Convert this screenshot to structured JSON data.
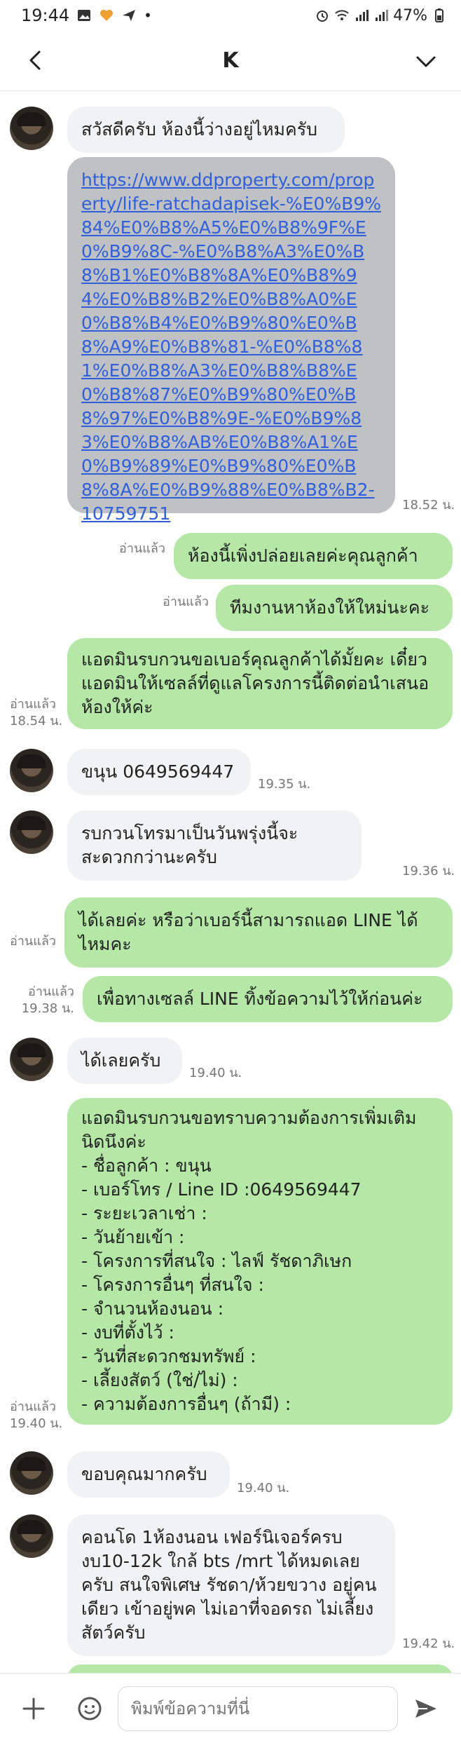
{
  "status": {
    "time": "19:44",
    "battery": "47%"
  },
  "header": {
    "title": "K"
  },
  "messages": {
    "m1": {
      "text": "สวัสดีครับ ห้องนี้ว่างอยู่ไหมครับ"
    },
    "m2": {
      "link": "https://www.ddproperty.com/property/life-ratchadapisek-%E0%B9%84%E0%B8%A5%E0%B8%9F%E0%B9%8C-%E0%B8%A3%E0%B8%B1%E0%B8%8A%E0%B8%94%E0%B8%B2%E0%B8%A0%E0%B8%B4%E0%B9%80%E0%B8%A9%E0%B8%81-%E0%B8%81%E0%B8%A3%E0%B8%B8%E0%B8%87%E0%B9%80%E0%B8%97%E0%B8%9E-%E0%B9%83%E0%B8%AB%E0%B8%A1%E0%B9%89%E0%B9%80%E0%B8%8A%E0%B9%88%E0%B8%B2-10759751",
      "time": "18.52 น."
    },
    "m3": {
      "text": "ห้องนี้เพิ่งปล่อยเลยค่ะคุณลูกค้า",
      "read": "อ่านแล้ว"
    },
    "m4": {
      "text": "ทีมงานหาห้องให้ใหม่นะคะ",
      "read": "อ่านแล้ว"
    },
    "m5": {
      "text": "แอดมินรบกวนขอเบอร์คุณลูกค้าได้มั้ยคะ เดี๋ยวแอดมินให้เซลล์ที่ดูแลโครงการนี้ติดต่อนำเสนอห้องให้ค่ะ",
      "read": "อ่านแล้ว",
      "time": "18.54 น."
    },
    "m6": {
      "text": "ขนุน 0649569447",
      "time": "19.35 น."
    },
    "m7": {
      "text": "รบกวนโทรมาเป็นวันพรุ่งนี้จะสะดวกกว่านะครับ",
      "time": "19.36 น."
    },
    "m8": {
      "text": "ได้เลยค่ะ หรือว่าเบอร์นี้สามารถแอด LINE ได้ไหมคะ",
      "read": "อ่านแล้ว"
    },
    "m9": {
      "text": "เพื่อทางเซลล์ LINE ทิ้งข้อความไว้ให้ก่อนค่ะ",
      "read": "อ่านแล้ว",
      "time": "19.38 น."
    },
    "m10": {
      "text": "ได้เลยครับ",
      "time": "19.40 น."
    },
    "m11": {
      "text": "แอดมินรบกวนขอทราบความต้องการเพิ่มเติมนิดนึงค่ะ\n- ชื่อลูกค้า : ขนุน\n- เบอร์โทร / Line ID :0649569447\n- ระยะเวลาเช่า :\n- วันย้ายเข้า :\n- โครงการที่สนใจ : ไลฟ์ รัชดาภิเษก\n- โครงการอื่นๆ ที่สนใจ :\n- จำนวนห้องนอน :\n- งบที่ตั้งไว้ :\n- วันที่สะดวกชมทรัพย์ :\n- เลี้ยงสัตว์ (ใช่/ไม่) :\n- ความต้องการอื่นๆ (ถ้ามี) :",
      "read": "อ่านแล้ว",
      "time": "19.40 น."
    },
    "m12": {
      "text": "ขอบคุณมากครับ",
      "time": "19.40 น."
    },
    "m13": {
      "text": "คอนโด 1ห้องนอน เฟอร์นิเจอร์ครบ งบ10-12k ใกล้ bts /mrt ได้หมดเลยครับ สนใจพิเศษ รัชดา/ห้วยขวาง อยู่คนเดียว เข้าอยู่พค ไม่เอาที่จอดรถ ไม่เลี้ยงสัตว์ครับ",
      "time": "19.42 น."
    }
  },
  "composer": {
    "placeholder": "พิมพ์ข้อความที่นี่"
  },
  "colors": {
    "outgoing": "#b5e8a6",
    "incoming": "#f1f2f4",
    "link_bubble": "#bfc1c5",
    "link": "#2f5fd9"
  }
}
